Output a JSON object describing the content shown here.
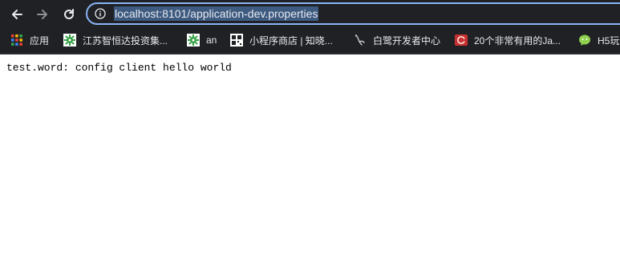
{
  "address_bar": {
    "url": "localhost:8101/application-dev.properties"
  },
  "bookmarks": [
    {
      "label": "应用",
      "icon": "apps-grid-icon"
    },
    {
      "label": "江苏智恒达投资集...",
      "icon": "green-gear-icon"
    },
    {
      "label": "an",
      "icon": "green-gear-icon"
    },
    {
      "label": "小程序商店 | 知晓...",
      "icon": "qr-icon"
    },
    {
      "label": "白鹭开发者中心",
      "icon": "egret-bird-icon"
    },
    {
      "label": "20个非常有用的Ja...",
      "icon": "csdn-icon"
    },
    {
      "label": "H5玩",
      "icon": "wechat-bubble-icon"
    }
  ],
  "page": {
    "text": "test.word: config client hello world"
  }
}
